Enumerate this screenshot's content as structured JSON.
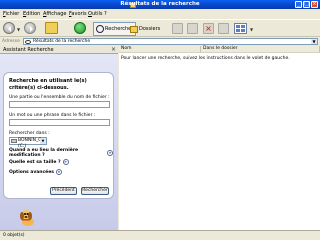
{
  "window": {
    "title": "Résultats de la recherche"
  },
  "menu": [
    "Fichier",
    "Edition",
    "Affichage",
    "Favoris",
    "Outils",
    "?"
  ],
  "toolbar": {
    "search_label": "Rechercher",
    "folders_label": "Dossiers"
  },
  "address": {
    "label": "Adresse",
    "value": "Résultats de la recherche"
  },
  "left_pane": {
    "header": "Assistant Recherche",
    "heading": "Recherche en utilisant le(s) critère(s) ci-dessous.",
    "name_label": "Une partie ou l'ensemble du nom de fichier :",
    "name_value": "",
    "phrase_label": "Un mot ou une phrase dans le fichier :",
    "phrase_value": "",
    "lookin_label": "Rechercher dans :",
    "lookin_value": "BONNIN_C (C:)",
    "options": [
      "Quand a eu lieu la dernière modification ?",
      "Quelle est sa taille ?",
      "Options avancées"
    ],
    "back_button": "Précédent",
    "search_button": "Rechercher"
  },
  "results": {
    "columns": [
      "Nom",
      "Dans le dossier"
    ],
    "message": "Pour lancer une recherche, suivez les instructions dans le volet de gauche."
  },
  "status": {
    "text": "0 objet(s)"
  }
}
